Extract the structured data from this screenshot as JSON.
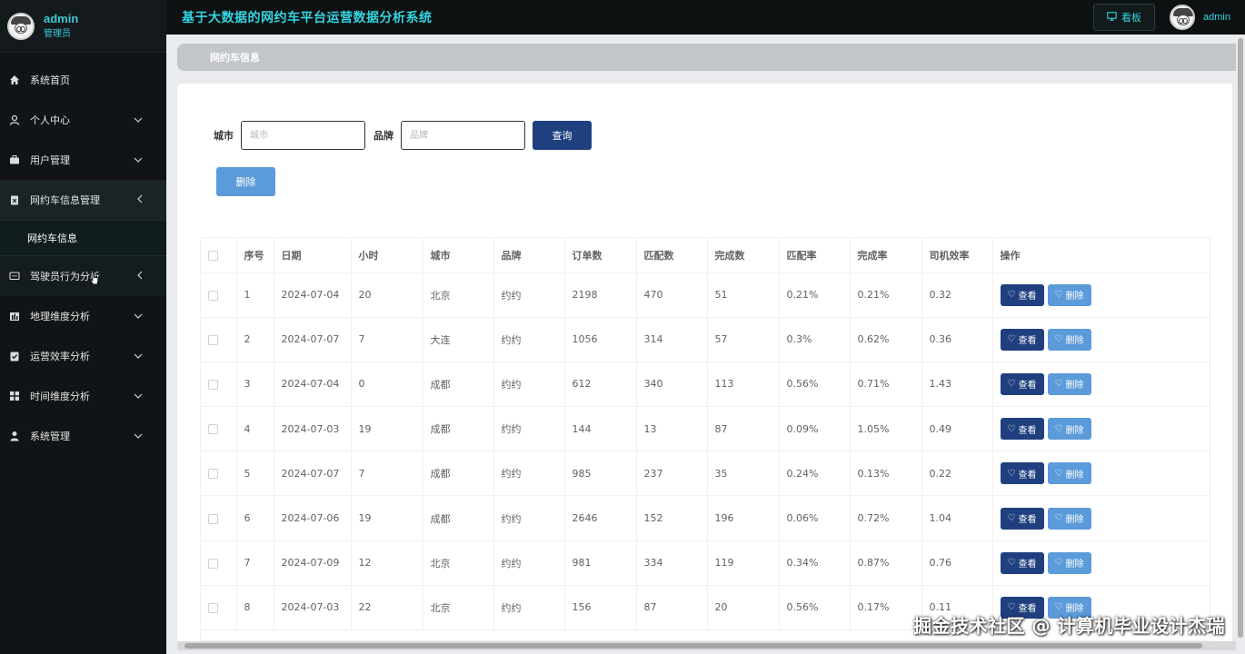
{
  "app": {
    "title": "基于大数据的网约车平台运营数据分析系统",
    "kanban_label": "看板",
    "user": "admin",
    "role": "管理员"
  },
  "sidebar": {
    "items": [
      {
        "label": "系统首页",
        "icon": "home-icon"
      },
      {
        "label": "个人中心",
        "icon": "user-icon"
      },
      {
        "label": "用户管理",
        "icon": "briefcase-icon"
      },
      {
        "label": "网约车信息管理",
        "icon": "clipboard-icon"
      },
      {
        "label": "驾驶员行为分析",
        "icon": "chat-icon"
      },
      {
        "label": "地理维度分析",
        "icon": "bar-chart-icon"
      },
      {
        "label": "运营效率分析",
        "icon": "check-list-icon"
      },
      {
        "label": "时间维度分析",
        "icon": "grid-icon"
      },
      {
        "label": "系统管理",
        "icon": "person-icon"
      }
    ],
    "sub_item": "网约车信息"
  },
  "breadcrumb": "网约车信息",
  "search": {
    "city_label": "城市",
    "city_placeholder": "城市",
    "brand_label": "品牌",
    "brand_placeholder": "品牌",
    "query_label": "查询",
    "delete_label": "删除"
  },
  "table": {
    "headers": [
      "序号",
      "日期",
      "小时",
      "城市",
      "品牌",
      "订单数",
      "匹配数",
      "完成数",
      "匹配率",
      "完成率",
      "司机效率",
      "操作"
    ],
    "view_label": "查看",
    "delete_label": "删除",
    "rows": [
      [
        "1",
        "2024-07-04",
        "20",
        "北京",
        "约约",
        "2198",
        "470",
        "51",
        "0.21%",
        "0.21%",
        "0.32"
      ],
      [
        "2",
        "2024-07-07",
        "7",
        "大连",
        "约约",
        "1056",
        "314",
        "57",
        "0.3%",
        "0.62%",
        "0.36"
      ],
      [
        "3",
        "2024-07-04",
        "0",
        "成都",
        "约约",
        "612",
        "340",
        "113",
        "0.56%",
        "0.71%",
        "1.43"
      ],
      [
        "4",
        "2024-07-03",
        "19",
        "成都",
        "约约",
        "144",
        "13",
        "87",
        "0.09%",
        "1.05%",
        "0.49"
      ],
      [
        "5",
        "2024-07-07",
        "7",
        "成都",
        "约约",
        "985",
        "237",
        "35",
        "0.24%",
        "0.13%",
        "0.22"
      ],
      [
        "6",
        "2024-07-06",
        "19",
        "成都",
        "约约",
        "2646",
        "152",
        "196",
        "0.06%",
        "0.72%",
        "1.04"
      ],
      [
        "7",
        "2024-07-09",
        "12",
        "北京",
        "约约",
        "981",
        "334",
        "119",
        "0.34%",
        "0.87%",
        "0.76"
      ],
      [
        "8",
        "2024-07-03",
        "22",
        "北京",
        "约约",
        "156",
        "87",
        "20",
        "0.56%",
        "0.17%",
        "0.11"
      ]
    ]
  },
  "watermark": "掘金技术社区 @ 计算机毕业设计杰瑞",
  "colors": {
    "accent": "#35d4e0",
    "primary_button": "#1f3f7f",
    "secondary_button": "#5b9bd9",
    "sidebar_bg": "#111416"
  }
}
